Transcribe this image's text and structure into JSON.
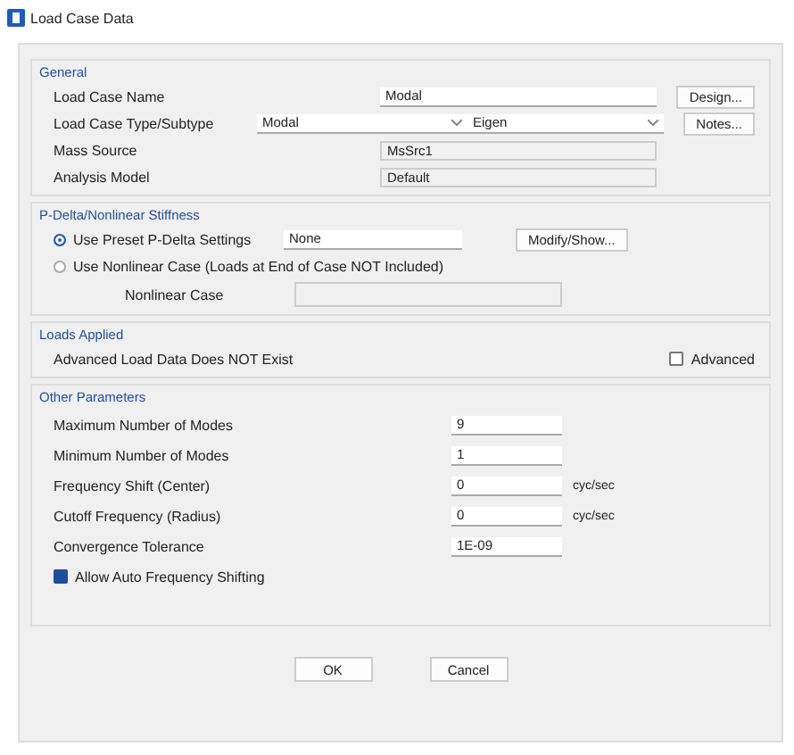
{
  "window": {
    "title": "Load Case Data"
  },
  "general": {
    "title": "General",
    "name": {
      "label": "Load Case Name",
      "value": "Modal",
      "button": "Design..."
    },
    "type": {
      "label": "Load Case Type/Subtype",
      "type": "Modal",
      "subtype": "Eigen",
      "button": "Notes..."
    },
    "mass_source": {
      "label": "Mass Source",
      "value": "MsSrc1"
    },
    "analysis_model": {
      "label": "Analysis Model",
      "value": "Default"
    }
  },
  "pdelta": {
    "title": "P-Delta/Nonlinear Stiffness",
    "options": [
      {
        "label": "Use Preset P-Delta Settings",
        "selected": true,
        "value": "None",
        "button": "Modify/Show..."
      },
      {
        "label": "Use Nonlinear Case  (Loads at End of Case NOT Included)",
        "selected": false
      }
    ],
    "nonlinear_case": {
      "label": "Nonlinear Case"
    }
  },
  "loads": {
    "title": "Loads Applied",
    "text": "Advanced Load Data Does NOT Exist",
    "advanced": {
      "label": "Advanced",
      "checked": false
    }
  },
  "other": {
    "title": "Other Parameters",
    "params": [
      {
        "label": "Maximum Number of Modes",
        "value": "9"
      },
      {
        "label": "Minimum Number of Modes",
        "value": "1"
      },
      {
        "label": "Frequency Shift (Center)",
        "value": "0",
        "unit": "cyc/sec"
      },
      {
        "label": "Cutoff Frequency (Radius)",
        "value": "0",
        "unit": "cyc/sec"
      },
      {
        "label": "Convergence Tolerance",
        "value": "1E-09"
      }
    ],
    "auto_shift": {
      "label": "Allow Auto Frequency Shifting",
      "checked": true
    }
  },
  "buttons": [
    "OK",
    "Cancel"
  ]
}
